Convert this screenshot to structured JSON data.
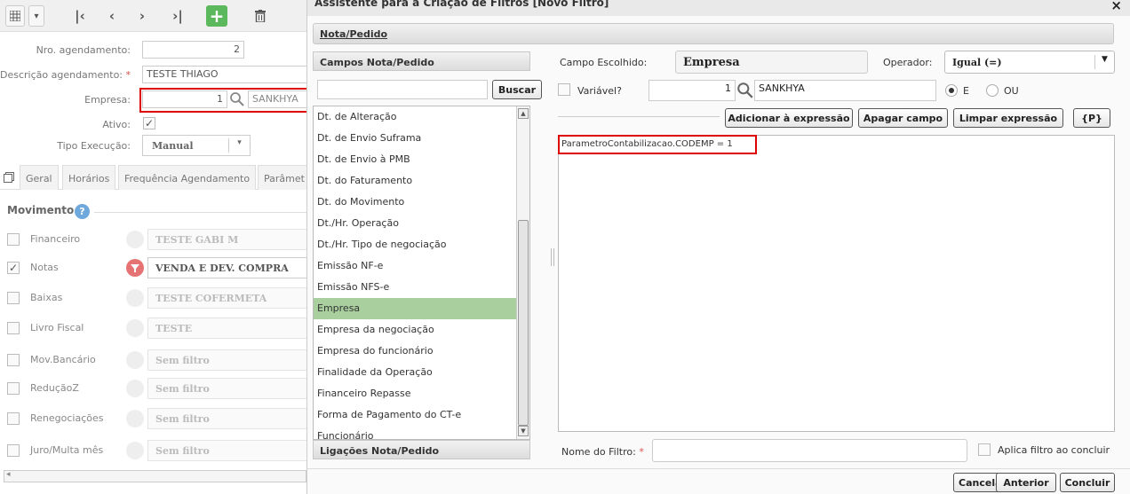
{
  "background": {
    "fields": {
      "nro_label": "Nro. agendamento:",
      "nro_value": "2",
      "desc_label": "Descrição agendamento:",
      "desc_value": "TESTE THIAGO",
      "empresa_label": "Empresa:",
      "empresa_code": "1",
      "empresa_name": "SANKHYA",
      "ativo_label": "Ativo:",
      "tipo_label": "Tipo Execução:",
      "tipo_value": "Manual"
    },
    "tabs": [
      "Geral",
      "Horários",
      "Frequência Agendamento",
      "Parâmet"
    ],
    "movimento_title": "Movimento",
    "movimento_help": "?",
    "movimento": [
      {
        "label": "Financeiro",
        "filter": "TESTE GABI M",
        "checked": false
      },
      {
        "label": "Notas",
        "filter": "VENDA E DEV. COMPRA",
        "checked": true
      },
      {
        "label": "Baixas",
        "filter": "TESTE COFERMETA",
        "checked": false
      },
      {
        "label": "Livro Fiscal",
        "filter": "TESTE",
        "checked": false
      },
      {
        "label": "Mov.Bancário",
        "filter": "Sem filtro",
        "checked": false
      },
      {
        "label": "ReduçãoZ",
        "filter": "Sem filtro",
        "checked": false
      },
      {
        "label": "Renegociações",
        "filter": "Sem filtro",
        "checked": false
      },
      {
        "label": "Juro/Multa mês",
        "filter": "Sem filtro",
        "checked": false
      }
    ],
    "checkmark": "✓"
  },
  "modal": {
    "title": "Assistente para a Criação de Filtros  [Novo Filtro]",
    "close": "×",
    "section": "Nota/Pedido",
    "fields_header": "Campos Nota/Pedido",
    "search_button": "Buscar",
    "fields": [
      "Dt. de Alteração",
      "Dt. de Envio Suframa",
      "Dt. de Envio à PMB",
      "Dt. do Faturamento",
      "Dt. do Movimento",
      "Dt./Hr. Operação",
      "Dt./Hr. Tipo de negociação",
      "Emissão NF-e",
      "Emissão NFS-e",
      "Empresa",
      "Empresa da negociação",
      "Empresa do funcionário",
      "Finalidade da Operação",
      "Financeiro Repasse",
      "Forma de Pagamento do CT-e",
      "Funcionário"
    ],
    "selected_field": "Empresa",
    "links_header": "Ligações Nota/Pedido",
    "campo_label": "Campo Escolhido:",
    "campo_value": "Empresa",
    "operador_label": "Operador:",
    "operador_value": "Igual (=)",
    "variavel_label": "Variável?",
    "value_code": "1",
    "value_name": "SANKHYA",
    "radio_e": "E",
    "radio_ou": "OU",
    "btn_add": "Adicionar à expressão",
    "btn_delete": "Apagar campo",
    "btn_clear": "Limpar expressão",
    "btn_p": "{P}",
    "expression": "ParametroContabilizacao.CODEMP = 1",
    "nome_label": "Nome do Filtro:",
    "nome_value": "",
    "aplica_label": "Aplica filtro ao concluir",
    "btn_cancel": "Cancelar",
    "btn_prev": "Anterior",
    "btn_finish": "Concluir",
    "required_mark": "*"
  }
}
